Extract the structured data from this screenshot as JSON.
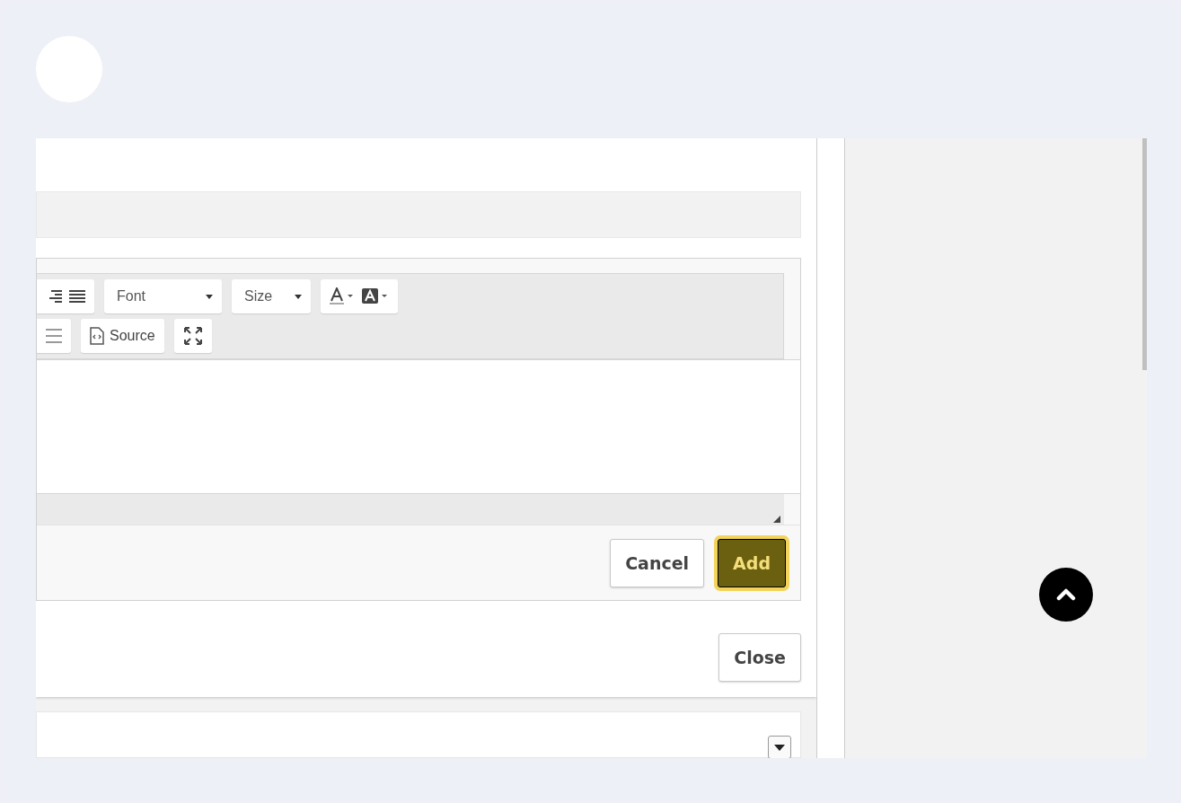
{
  "editor": {
    "toolbar_row_1": [
      {
        "kind": "align"
      },
      {
        "kind": "combo",
        "label": "Font"
      },
      {
        "kind": "combo",
        "label": "Size"
      },
      {
        "kind": "colors"
      }
    ],
    "toolbar_row_2": [
      {
        "kind": "rule"
      },
      {
        "kind": "source",
        "label": "Source"
      },
      {
        "kind": "maximize"
      }
    ],
    "buttons": [
      {
        "label": "Cancel",
        "kind": "default",
        "highlighted": false
      },
      {
        "label": "Add",
        "kind": "primary",
        "highlighted": true
      }
    ]
  },
  "close_button": {
    "label": "Close"
  }
}
